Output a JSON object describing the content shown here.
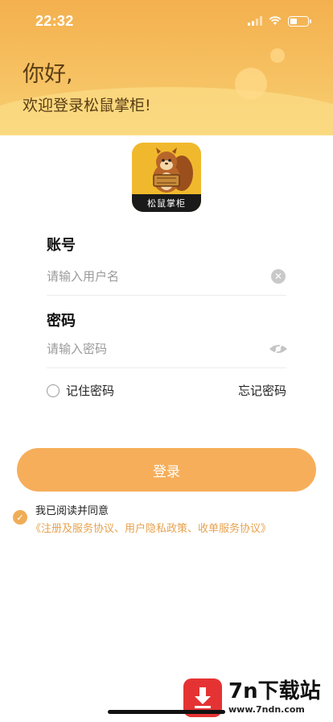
{
  "status_bar": {
    "time": "22:32",
    "battery_level": 0.4
  },
  "header": {
    "greeting": "你好,",
    "welcome": "欢迎登录松鼠掌柜!"
  },
  "logo": {
    "text": "松鼠掌柜"
  },
  "account": {
    "label": "账号",
    "placeholder": "请输入用户名"
  },
  "password": {
    "label": "密码",
    "placeholder": "请输入密码"
  },
  "remember": {
    "label": "记住密码",
    "checked": false
  },
  "forgot": {
    "label": "忘记密码"
  },
  "login_button": {
    "label": "登录"
  },
  "agreement": {
    "checked": true,
    "text": "我已阅读并同意",
    "links": "《注册及服务协议、用户隐私政策、收单服务协议》"
  },
  "watermark": {
    "title": "7n下载站",
    "url": "www.7ndn.com"
  },
  "colors": {
    "accent": "#f6ae5a",
    "header": "#f4b04e",
    "link": "#e6a24f"
  }
}
